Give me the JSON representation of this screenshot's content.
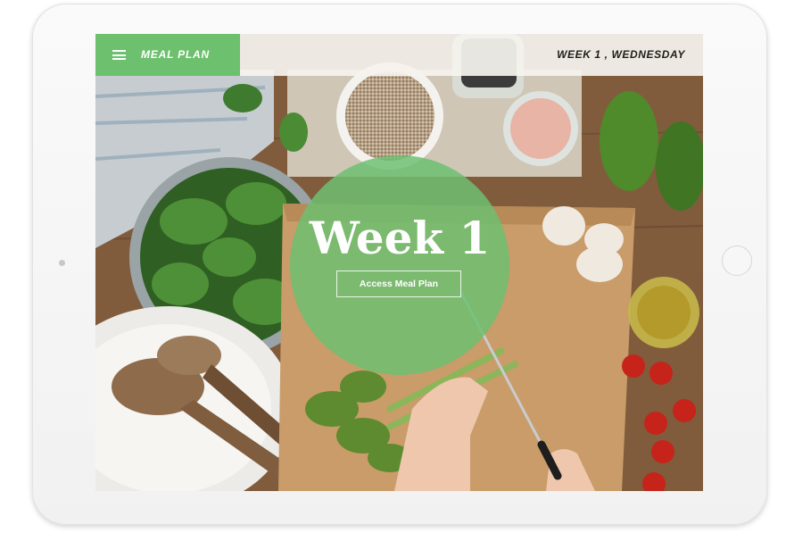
{
  "header": {
    "menu_title": "MEAL PLAN",
    "week_day": "WEEK 1 , WEDNESDAY",
    "menu_icon": "hamburger-icon",
    "accent_color": "#6cc06e"
  },
  "hero": {
    "title": "Week 1",
    "button_label": "Access Meal Plan",
    "circle_color": "#6cc06e"
  }
}
